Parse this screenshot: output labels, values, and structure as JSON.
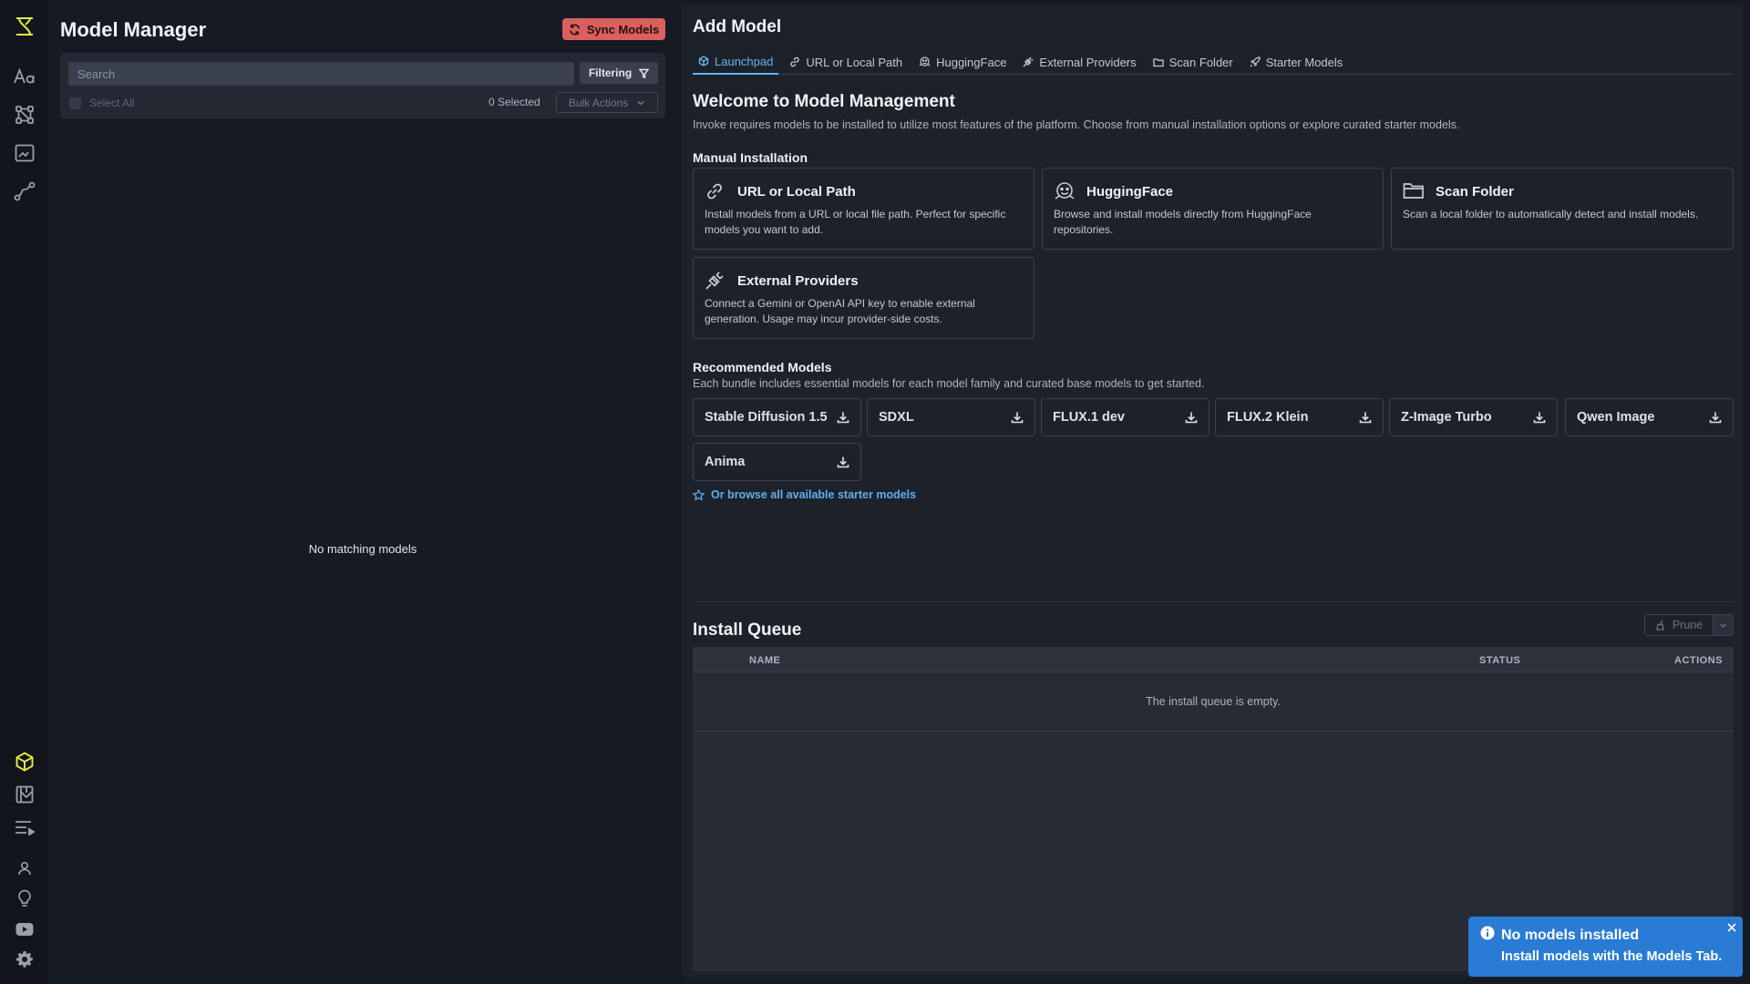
{
  "colors": {
    "accent": "#67b5f0",
    "rail_active": "#e4ec44",
    "sync_button": "#d9605e",
    "toast": "#2a7bd4"
  },
  "rail": {
    "top_icons": [
      "logo-icon",
      "text-style-icon",
      "nodes-workflow-icon",
      "canvas-icon",
      "path-curve-icon"
    ],
    "bottom_icons": [
      "models-cube-icon",
      "gallery-icon",
      "queue-list-icon",
      "user-icon",
      "lightbulb-icon",
      "youtube-icon",
      "settings-gear-icon"
    ],
    "active": "models-cube-icon"
  },
  "model_manager": {
    "title": "Model Manager",
    "sync_label": "Sync Models",
    "search_placeholder": "Search",
    "filter_label": "Filtering",
    "select_all_label": "Select All",
    "selected_count": "0 Selected",
    "bulk_actions_label": "Bulk Actions",
    "empty_message": "No matching models"
  },
  "add_model": {
    "title": "Add Model",
    "tabs": [
      {
        "label": "Launchpad",
        "icon": "launchpad-icon",
        "active": true
      },
      {
        "label": "URL or Local Path",
        "icon": "link-icon"
      },
      {
        "label": "HuggingFace",
        "icon": "huggingface-icon"
      },
      {
        "label": "External Providers",
        "icon": "plug-icon"
      },
      {
        "label": "Scan Folder",
        "icon": "folder-icon"
      },
      {
        "label": "Starter Models",
        "icon": "rocket-icon"
      }
    ],
    "welcome_title": "Welcome to Model Management",
    "welcome_text": "Invoke requires models to be installed to utilize most features of the platform. Choose from manual installation options or explore curated starter models.",
    "manual_heading": "Manual Installation",
    "cards": [
      {
        "title": "URL or Local Path",
        "desc": "Install models from a URL or local file path. Perfect for specific models you want to add.",
        "icon": "link-icon"
      },
      {
        "title": "HuggingFace",
        "desc": "Browse and install models directly from HuggingFace repositories.",
        "icon": "huggingface-icon"
      },
      {
        "title": "Scan Folder",
        "desc": "Scan a local folder to automatically detect and install models.",
        "icon": "folder-icon"
      },
      {
        "title": "External Providers",
        "desc": "Connect a Gemini or OpenAI API key to enable external generation. Usage may incur provider-side costs.",
        "icon": "plug-icon"
      }
    ],
    "recommended_heading": "Recommended Models",
    "recommended_text": "Each bundle includes essential models for each model family and curated base models to get started.",
    "bundles": [
      "Stable Diffusion 1.5",
      "SDXL",
      "FLUX.1 dev",
      "FLUX.2 Klein",
      "Z-Image Turbo",
      "Qwen Image",
      "Anima"
    ],
    "browse_link": "Or browse all available starter models"
  },
  "install_queue": {
    "title": "Install Queue",
    "prune_label": "Prune",
    "columns": {
      "name": "NAME",
      "status": "STATUS",
      "actions": "ACTIONS"
    },
    "empty_message": "The install queue is empty."
  },
  "toast": {
    "title": "No models installed",
    "message": "Install models with the Models Tab."
  }
}
